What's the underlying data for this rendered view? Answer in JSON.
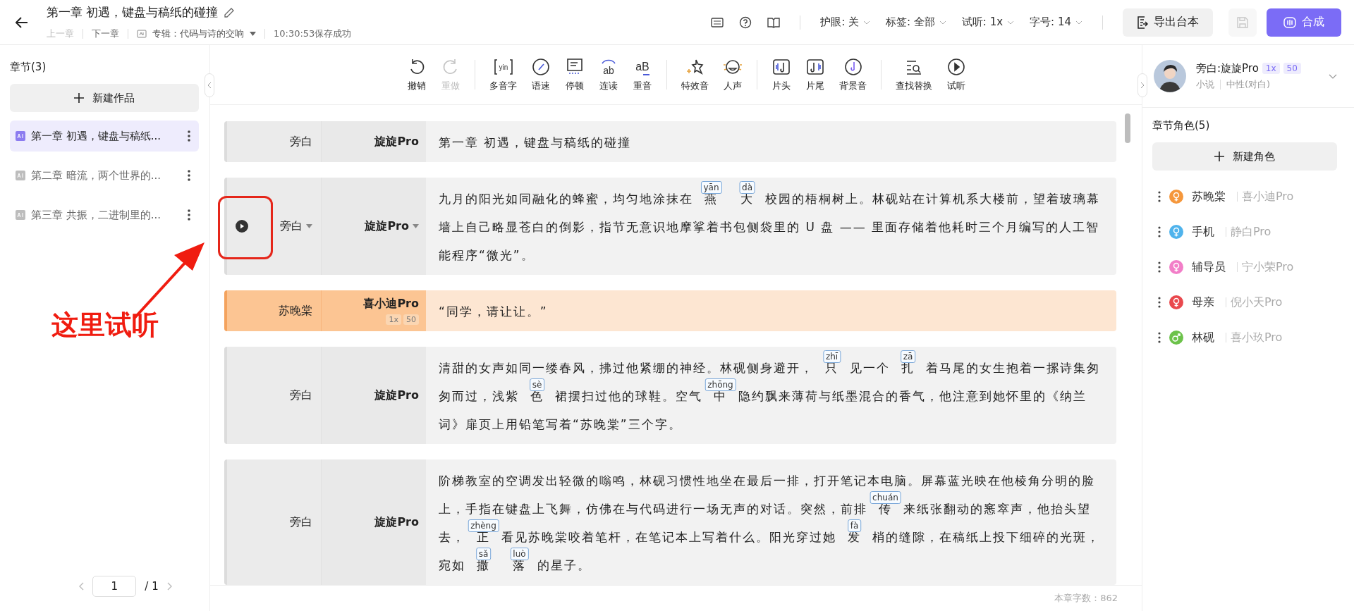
{
  "header": {
    "title": "第一章 初遇，键盘与稿纸的碰撞",
    "nav": [
      {
        "label": "上一章",
        "disabled": true
      },
      {
        "label": "下一章",
        "disabled": false
      }
    ],
    "album": "专辑：代码与诗的交响",
    "save_status": "10:30:53保存成功",
    "dropdowns": [
      "护眼: 关",
      "标签: 全部",
      "试听: 1x",
      "字号: 14"
    ],
    "export_button": "导出台本",
    "save_disabled": true,
    "synth_button": "合成"
  },
  "toolbar": [
    [
      {
        "label": "撤销",
        "kind": "undo",
        "disabled": false
      },
      {
        "label": "重做",
        "kind": "redo",
        "disabled": true
      }
    ],
    [
      {
        "label": "多音字",
        "kind": "bracket",
        "glyph": "yin",
        "disabled": false
      },
      {
        "label": "语速",
        "kind": "gauge",
        "disabled": false
      },
      {
        "label": "停顿",
        "kind": "pause",
        "disabled": false
      },
      {
        "label": "连读",
        "kind": "arc",
        "glyph": "ab",
        "disabled": false
      },
      {
        "label": "重音",
        "kind": "under",
        "glyph": "aB",
        "disabled": false
      }
    ],
    [
      {
        "label": "特效音",
        "kind": "sparkle",
        "disabled": false
      },
      {
        "label": "人声",
        "kind": "smile",
        "disabled": false
      }
    ],
    [
      {
        "label": "片头",
        "kind": "intro",
        "disabled": false
      },
      {
        "label": "片尾",
        "kind": "outro",
        "disabled": false
      },
      {
        "label": "背景音",
        "kind": "disc",
        "disabled": false
      }
    ],
    [
      {
        "label": "查找替换",
        "kind": "find",
        "disabled": false
      },
      {
        "label": "试听",
        "kind": "play",
        "disabled": false
      }
    ]
  ],
  "sidebar": {
    "title": "章节(3)",
    "new_button": "新建作品",
    "items": [
      {
        "label": "第一章 初遇，键盘与稿纸...",
        "selected": true
      },
      {
        "label": "第二章 暗流，两个世界的...",
        "selected": false
      },
      {
        "label": "第三章 共振，二进制里的...",
        "selected": false
      }
    ],
    "pagination": {
      "page": "1",
      "total": "/ 1"
    }
  },
  "rows": [
    {
      "speaker": "旁白",
      "voice": "旋旋Pro",
      "highlighted": false,
      "active": false,
      "segments": [
        {
          "text": "第一章 初遇，键盘与稿纸的碰撞"
        }
      ]
    },
    {
      "speaker": "旁白",
      "voice": "旋旋Pro",
      "highlighted": false,
      "active": true,
      "segments": [
        {
          "text": "九月的阳光如同融化的蜂蜜，均匀地涂抹在"
        },
        {
          "text": "燕",
          "pinyin": "yān"
        },
        {
          "text": "大",
          "pinyin": "dà"
        },
        {
          "text": "校园的梧桐树上。林砚站在计算机系大楼前，望着玻璃幕墙上自己略显苍白的倒影，指节无意识地摩挲着书包侧袋里的 U 盘 —— 里面存储着他耗时三个月编写的人工智能程序“微光”。"
        }
      ]
    },
    {
      "speaker": "苏晚棠",
      "voice": "喜小迪Pro",
      "badges": [
        "1x",
        "50"
      ],
      "highlighted": true,
      "active": false,
      "segments": [
        {
          "text": "“同学，请让让。”"
        }
      ]
    },
    {
      "speaker": "旁白",
      "voice": "旋旋Pro",
      "highlighted": false,
      "active": false,
      "segments": [
        {
          "text": "清甜的女声如同一缕春风，拂过他紧绷的神经。林砚侧身避开，"
        },
        {
          "text": "只",
          "pinyin": "zhī"
        },
        {
          "text": "见一个"
        },
        {
          "text": "扎",
          "pinyin": "zā"
        },
        {
          "text": "着马尾的女生抱着一摞诗集匆匆而过，浅紫"
        },
        {
          "text": "色",
          "pinyin": "sè"
        },
        {
          "text": "裙摆扫过他的球鞋。空气"
        },
        {
          "text": "中",
          "pinyin": "zhōng"
        },
        {
          "text": "隐约飘来薄荷与纸墨混合的香气，他注意到她怀里的《纳兰词》扉页上用铅笔写着“苏晚棠”三个字。"
        }
      ]
    },
    {
      "speaker": "旁白",
      "voice": "旋旋Pro",
      "highlighted": false,
      "active": false,
      "segments": [
        {
          "text": "阶梯教室的空调发出轻微的嗡鸣，林砚习惯性地坐在最后一排，打开笔记本电脑。屏幕蓝光映在他棱角分明的脸上，手指在键盘上飞舞，仿佛在与代码进行一场无声的对话。突然，前排"
        },
        {
          "text": "传",
          "pinyin": "chuán"
        },
        {
          "text": "来纸张翻动的窸窣声，他抬头望去，"
        },
        {
          "text": "正",
          "pinyin": "zhèng"
        },
        {
          "text": "看见苏晚棠咬着笔杆，在笔记本上写着什么。阳光穿过她"
        },
        {
          "text": "发",
          "pinyin": "fà"
        },
        {
          "text": "梢的缝隙，在稿纸上投下细碎的光斑，宛如"
        },
        {
          "text": "撒",
          "pinyin": "sǎ"
        },
        {
          "text": "落",
          "pinyin": "luò"
        },
        {
          "text": "的星子。"
        }
      ]
    }
  ],
  "word_count": "本章字数：862",
  "annotation": "这里试听",
  "narrator": {
    "name": "旁白:旋旋Pro",
    "badges": [
      "1x",
      "50"
    ],
    "category": "小说",
    "style": "中性(对白)"
  },
  "roles": {
    "title": "章节角色(5)",
    "new_button": "新建角色",
    "items": [
      {
        "name": "苏晚棠",
        "voice": "喜小迪Pro",
        "color": "#f5973b",
        "kind": "female"
      },
      {
        "name": "手机",
        "voice": "静白Pro",
        "color": "#4fb3ec",
        "kind": "female"
      },
      {
        "name": "辅导员",
        "voice": "宁小荣Pro",
        "color": "#f27ec8",
        "kind": "female"
      },
      {
        "name": "母亲",
        "voice": "倪小天Pro",
        "color": "#e9484d",
        "kind": "female"
      },
      {
        "name": "林砚",
        "voice": "喜小玖Pro",
        "color": "#6cc24a",
        "kind": "male"
      }
    ]
  }
}
